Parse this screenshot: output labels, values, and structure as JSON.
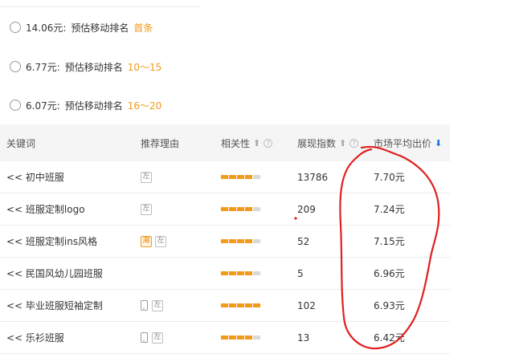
{
  "bid_options": [
    {
      "price": "14.06元:",
      "text": "预估移动排名",
      "rank": "首条"
    },
    {
      "price": "6.77元:",
      "text": "预估移动排名",
      "rank": "10～15"
    },
    {
      "price": "6.07元:",
      "text": "预估移动排名",
      "rank": "16～20"
    }
  ],
  "table": {
    "headers": {
      "keyword": "关键词",
      "reason": "推荐理由",
      "relevance": "相关性",
      "index": "展现指数",
      "price": "市场平均出价"
    },
    "rows": [
      {
        "keyword": "<< 初中班服",
        "tags": [
          "左"
        ],
        "mobile": false,
        "relevance": 4,
        "index": "13786",
        "price": "7.70元"
      },
      {
        "keyword": "<< 班服定制logo",
        "tags": [
          "左"
        ],
        "mobile": false,
        "relevance": 4,
        "index": "209",
        "price": "7.24元"
      },
      {
        "keyword": "<< 班服定制ins风格",
        "tags": [
          "潮",
          "左"
        ],
        "mobile": false,
        "relevance": 4,
        "index": "52",
        "price": "7.15元"
      },
      {
        "keyword": "<< 民国风幼儿园班服",
        "tags": [],
        "mobile": false,
        "relevance": 4,
        "index": "5",
        "price": "6.96元"
      },
      {
        "keyword": "<< 毕业班服短袖定制",
        "tags": [
          "左"
        ],
        "mobile": true,
        "relevance": 5,
        "index": "102",
        "price": "6.93元"
      },
      {
        "keyword": "<< 乐衫班服",
        "tags": [
          "左"
        ],
        "mobile": true,
        "relevance": 4,
        "index": "13",
        "price": "6.42元"
      }
    ]
  },
  "colors": {
    "accent": "#f29a1b",
    "sort_arrow": "#1a73d6",
    "annotation": "#e02020"
  }
}
